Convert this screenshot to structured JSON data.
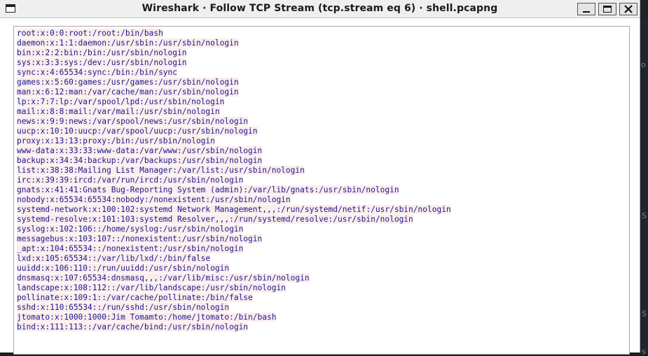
{
  "window": {
    "title": "Wireshark · Follow TCP Stream (tcp.stream eq 6) · shell.pcapng",
    "icon": "window-icon",
    "controls": {
      "minimize": "minimize-icon",
      "maximize": "maximize-icon",
      "close": "close-icon"
    }
  },
  "background": {
    "glyphs": [
      "o",
      "S",
      "S",
      "s"
    ]
  },
  "colors": {
    "client_text": "#1a1a8c",
    "client_bg": "#fbeded"
  },
  "stream": {
    "lines": [
      "root:x:0:0:root:/root:/bin/bash",
      "daemon:x:1:1:daemon:/usr/sbin:/usr/sbin/nologin",
      "bin:x:2:2:bin:/bin:/usr/sbin/nologin",
      "sys:x:3:3:sys:/dev:/usr/sbin/nologin",
      "sync:x:4:65534:sync:/bin:/bin/sync",
      "games:x:5:60:games:/usr/games:/usr/sbin/nologin",
      "man:x:6:12:man:/var/cache/man:/usr/sbin/nologin",
      "lp:x:7:7:lp:/var/spool/lpd:/usr/sbin/nologin",
      "mail:x:8:8:mail:/var/mail:/usr/sbin/nologin",
      "news:x:9:9:news:/var/spool/news:/usr/sbin/nologin",
      "uucp:x:10:10:uucp:/var/spool/uucp:/usr/sbin/nologin",
      "proxy:x:13:13:proxy:/bin:/usr/sbin/nologin",
      "www-data:x:33:33:www-data:/var/www:/usr/sbin/nologin",
      "backup:x:34:34:backup:/var/backups:/usr/sbin/nologin",
      "list:x:38:38:Mailing List Manager:/var/list:/usr/sbin/nologin",
      "irc:x:39:39:ircd:/var/run/ircd:/usr/sbin/nologin",
      "gnats:x:41:41:Gnats Bug-Reporting System (admin):/var/lib/gnats:/usr/sbin/nologin",
      "nobody:x:65534:65534:nobody:/nonexistent:/usr/sbin/nologin",
      "systemd-network:x:100:102:systemd Network Management,,,:/run/systemd/netif:/usr/sbin/nologin",
      "systemd-resolve:x:101:103:systemd Resolver,,,:/run/systemd/resolve:/usr/sbin/nologin",
      "syslog:x:102:106::/home/syslog:/usr/sbin/nologin",
      "messagebus:x:103:107::/nonexistent:/usr/sbin/nologin",
      "_apt:x:104:65534::/nonexistent:/usr/sbin/nologin",
      "lxd:x:105:65534::/var/lib/lxd/:/bin/false",
      "uuidd:x:106:110::/run/uuidd:/usr/sbin/nologin",
      "dnsmasq:x:107:65534:dnsmasq,,,:/var/lib/misc:/usr/sbin/nologin",
      "landscape:x:108:112::/var/lib/landscape:/usr/sbin/nologin",
      "pollinate:x:109:1::/var/cache/pollinate:/bin/false",
      "sshd:x:110:65534::/run/sshd:/usr/sbin/nologin",
      "jtomato:x:1000:1000:Jim Tomamto:/home/jtomato:/bin/bash",
      "bind:x:111:113::/var/cache/bind:/usr/sbin/nologin"
    ]
  }
}
